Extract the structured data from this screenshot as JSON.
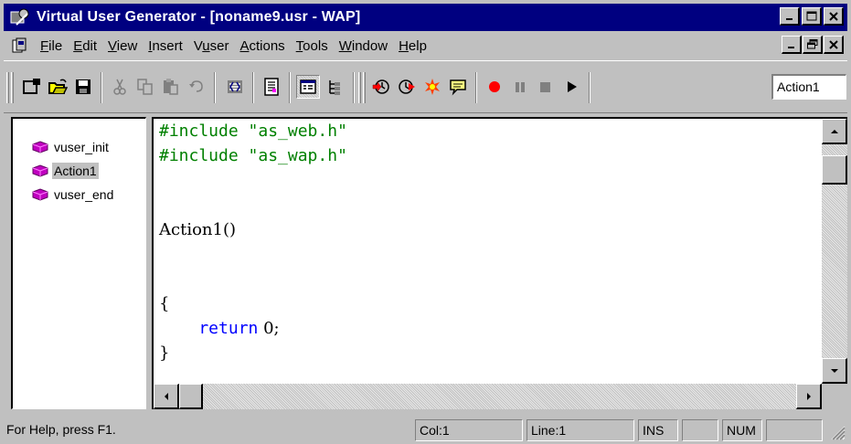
{
  "window": {
    "title": "Virtual User Generator - [noname9.usr - WAP]"
  },
  "menu": [
    {
      "pre": "",
      "key": "F",
      "post": "ile"
    },
    {
      "pre": "",
      "key": "E",
      "post": "dit"
    },
    {
      "pre": "",
      "key": "V",
      "post": "iew"
    },
    {
      "pre": "",
      "key": "I",
      "post": "nsert"
    },
    {
      "pre": "V",
      "key": "u",
      "post": "ser"
    },
    {
      "pre": "",
      "key": "A",
      "post": "ctions"
    },
    {
      "pre": "",
      "key": "T",
      "post": "ools"
    },
    {
      "pre": "",
      "key": "W",
      "post": "indow"
    },
    {
      "pre": "",
      "key": "H",
      "post": "elp"
    }
  ],
  "toolbar": {
    "action_selector": "Action1",
    "icons": [
      "new-icon",
      "open-icon",
      "save-icon",
      "cut-icon",
      "copy-icon",
      "paste-icon",
      "undo-icon",
      "compile-icon",
      "script-view-icon",
      "tree-view-icon",
      "tree-icon",
      "run-step-icon",
      "run-to-cursor-icon",
      "breakpoint-icon",
      "comment-icon",
      "record-icon",
      "pause-icon",
      "stop-icon",
      "run-icon"
    ],
    "colors": {
      "record": "#ff0000",
      "run": "#000000"
    }
  },
  "tree": {
    "items": [
      {
        "label": "vuser_init",
        "selected": false
      },
      {
        "label": "Action1",
        "selected": true
      },
      {
        "label": "vuser_end",
        "selected": false
      }
    ],
    "icon_color": "#c000c0"
  },
  "editor": {
    "line1_kw": "#include",
    "line1_str": " \"as_web.h\"",
    "line2_kw": "#include",
    "line2_str": " \"as_wap.h\"",
    "line5": "Action1()",
    "line8": "{",
    "line9_kw": "    return",
    "line9_rest": " 0;",
    "line10": "}",
    "colors": {
      "directive": "#008000",
      "keyword": "#0000ff"
    }
  },
  "statusbar": {
    "help": "For Help, press F1.",
    "col": "Col:1",
    "line": "Line:1",
    "ins": "INS",
    "num": "NUM"
  }
}
